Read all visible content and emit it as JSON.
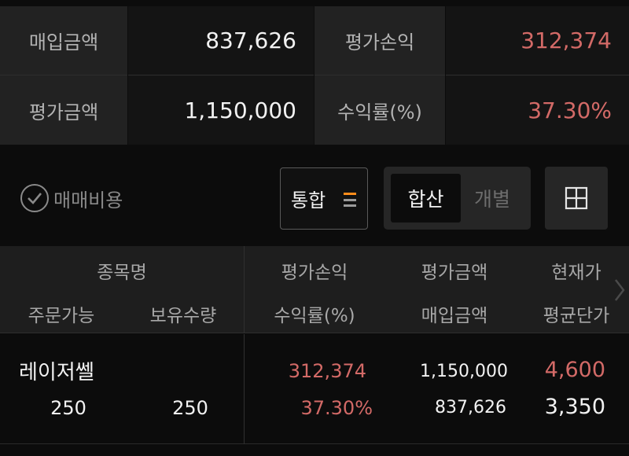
{
  "summary": {
    "purchase_amount_label": "매입금액",
    "purchase_amount_value": "837,626",
    "eval_pl_label": "평가손익",
    "eval_pl_value": "312,374",
    "eval_amount_label": "평가금액",
    "eval_amount_value": "1,150,000",
    "return_rate_label": "수익률(%)",
    "return_rate_value": "37.30%"
  },
  "controls": {
    "fee_label": "매매비용",
    "account_combo_label": "통합",
    "segment_combined": "합산",
    "segment_individual": "개별"
  },
  "table": {
    "headers": {
      "name": "종목명",
      "orderable": "주문가능",
      "holding_qty": "보유수량",
      "eval_pl": "평가손익",
      "return_rate": "수익률(%)",
      "eval_amount": "평가금액",
      "purchase_amount": "매입금액",
      "current_price": "현재가",
      "avg_price": "평균단가"
    },
    "rows": [
      {
        "name": "레이저쎌",
        "orderable": "250",
        "holding_qty": "250",
        "eval_pl": "312,374",
        "return_rate": "37.30%",
        "eval_amount": "1,150,000",
        "purchase_amount": "837,626",
        "current_price": "4,600",
        "avg_price": "3,350"
      }
    ]
  },
  "colors": {
    "positive": "#d36a67",
    "accent": "#ff8c1a",
    "background": "#0c0c0c"
  },
  "icons": {
    "fee_check": "check-circle-icon",
    "combo_menu": "menu-lines-icon",
    "add_grid": "plus-box-icon",
    "scroll_right": "chevron-right-icon"
  }
}
